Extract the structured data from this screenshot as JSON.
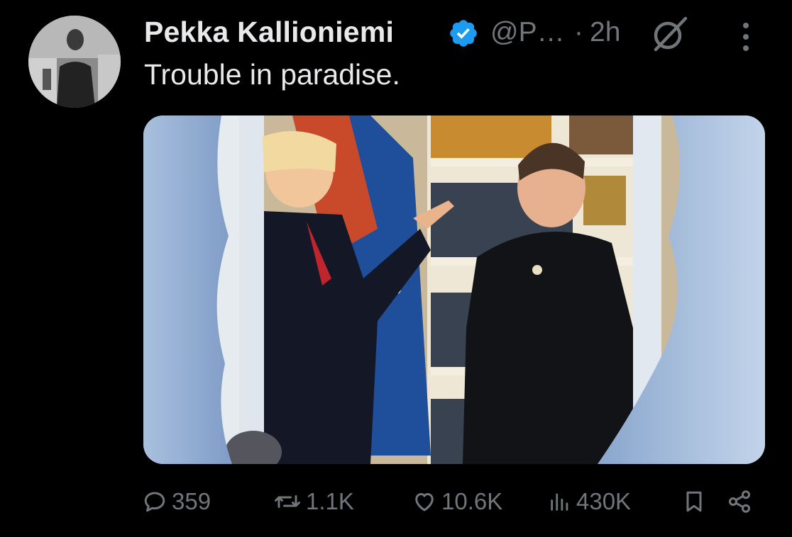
{
  "tweet": {
    "author_name": "Pekka Kallioniemi",
    "handle": "@P…",
    "separator": "·",
    "time": "2h",
    "text": "Trouble in paradise.",
    "verified_icon": "verified-badge-icon",
    "grok_icon": "grok-icon",
    "more_icon": "more-icon"
  },
  "actions": {
    "replies": "359",
    "reposts": "1.1K",
    "likes": "10.6K",
    "views": "430K",
    "icons": [
      "reply-icon",
      "repost-icon",
      "like-icon",
      "views-icon",
      "bookmark-icon",
      "share-icon"
    ]
  },
  "colors": {
    "background": "#000000",
    "primary_text": "#e7e9ea",
    "secondary_text": "#71767b",
    "verified_blue": "#1d9bf0"
  }
}
